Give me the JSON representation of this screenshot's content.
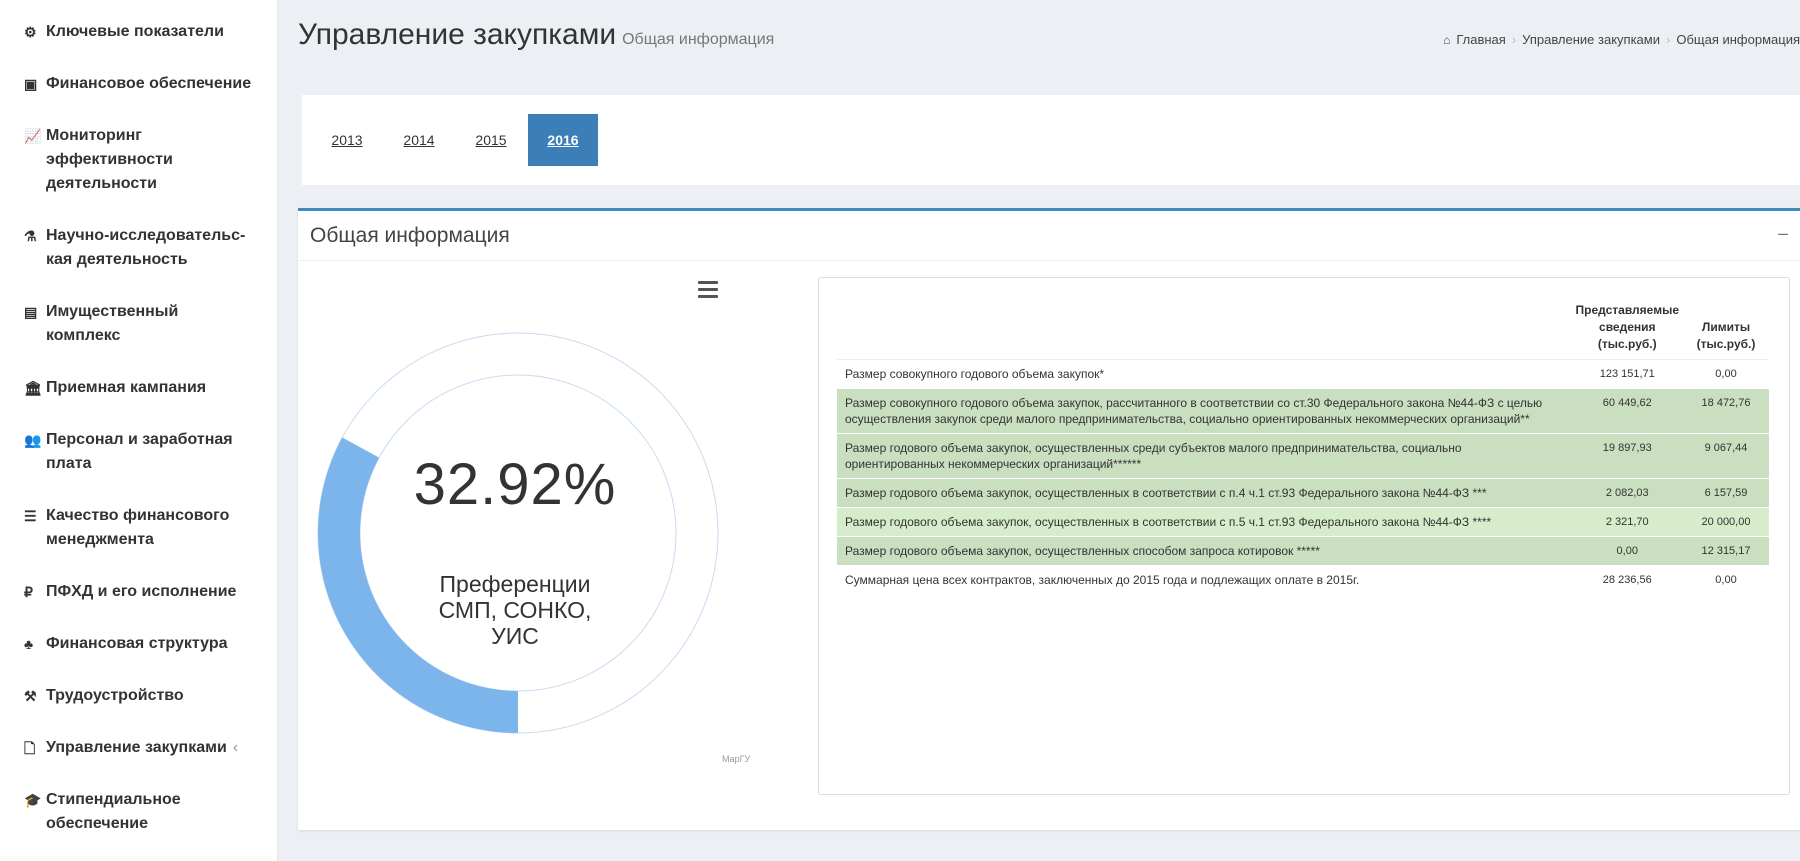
{
  "sidebar": {
    "items": [
      {
        "icon": "dashboard-icon",
        "glyph": "⚙",
        "label": "Ключевые показатели"
      },
      {
        "icon": "money-icon",
        "glyph": "▣",
        "label": "Финансовое обеспечение"
      },
      {
        "icon": "line-chart-icon",
        "glyph": "📈",
        "label": "Мониторинг\nэффективности\nдеятельности"
      },
      {
        "icon": "flask-icon",
        "glyph": "⚗",
        "label": "Научно-исследовательс-\nкая деятельность"
      },
      {
        "icon": "building-icon",
        "glyph": "▤",
        "label": "Имущественный\nкомплекс"
      },
      {
        "icon": "university-icon",
        "glyph": "🏛",
        "label": "Приемная кампания"
      },
      {
        "icon": "users-icon",
        "glyph": "👥",
        "label": "Персонал и заработная\nплата"
      },
      {
        "icon": "list-icon",
        "glyph": "☰",
        "label": "Качество финансового\nменеджмента"
      },
      {
        "icon": "ruble-icon",
        "glyph": "₽",
        "label": "ПФХД и его исполнение"
      },
      {
        "icon": "sitemap-icon",
        "glyph": "♣",
        "label": "Финансовая структура"
      },
      {
        "icon": "gavel-icon",
        "glyph": "⚒",
        "label": "Трудоустройство"
      },
      {
        "icon": "file-icon",
        "glyph": "🗋",
        "label": "Управление закупками",
        "chevron": "‹"
      },
      {
        "icon": "graduation-cap-icon",
        "glyph": "🎓",
        "label": "Стипендиальное\nобеспечение"
      }
    ]
  },
  "header": {
    "title": "Управление закупками",
    "subtitle": "Общая информация"
  },
  "breadcrumb": {
    "home_icon": "home-icon",
    "items": [
      "Главная",
      "Управление закупками",
      "Общая информация"
    ],
    "separator": "›"
  },
  "years": {
    "tabs": [
      "2013",
      "2014",
      "2015",
      "2016"
    ],
    "active": "2016"
  },
  "panel": {
    "title": "Общая информация",
    "collapse_symbol": "–"
  },
  "donut": {
    "percent_text": "32.92%",
    "percent_value": 32.92,
    "label": "Преференции\nСМП, СОНКО,\nУИС",
    "credit": "МарГУ",
    "fill_color": "#7cb5ec",
    "track_color": "#e8eef6"
  },
  "table": {
    "headers": [
      "",
      "Представляемые\nсведения\n(тыс.руб.)",
      "Лимиты\n(тыс.руб.)"
    ],
    "rows": [
      {
        "style": "plain",
        "label": "Размер совокупного годового объема закупок*",
        "value1": "123 151,71",
        "value2": "0,00"
      },
      {
        "style": "green",
        "label": "Размер совокупного годового объема закупок, рассчитанного в соответствии со ст.30 Федерального закона №44-ФЗ с целью осуществления закупок среди малого предпринимательства, социально ориентированных некоммерческих организаций**",
        "value1": "60 449,62",
        "value2": "18 472,76"
      },
      {
        "style": "green",
        "label": "Размер годового объема закупок, осуществленных среди субъектов малого предпринимательства, социально ориентированных некоммерческих организаций******",
        "value1": "19 897,93",
        "value2": "9 067,44"
      },
      {
        "style": "green",
        "label": "Размер годового объема закупок, осуществленных в соответствии с п.4 ч.1 ст.93 Федерального закона №44-ФЗ ***",
        "value1": "2 082,03",
        "value2": "6 157,59"
      },
      {
        "style": "green2",
        "label": "Размер годового объема закупок, осуществленных в соответствии с п.5 ч.1 ст.93 Федерального закона №44-ФЗ ****",
        "value1": "2 321,70",
        "value2": "20 000,00"
      },
      {
        "style": "green",
        "label": "Размер годового объема закупок, осуществленных способом запроса котировок *****",
        "value1": "0,00",
        "value2": "12 315,17"
      },
      {
        "style": "plain",
        "label": "Суммарная цена всех контрактов, заключенных до 2015 года и подлежащих оплате в 2015г.",
        "value1": "28 236,56",
        "value2": "0,00"
      }
    ]
  }
}
